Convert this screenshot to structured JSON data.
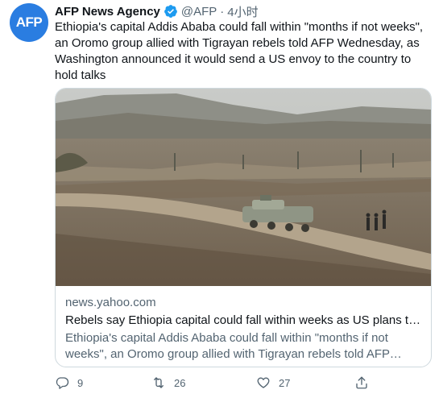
{
  "account": {
    "avatar_text": "AFP",
    "name": "AFP News Agency",
    "handle": "@AFP",
    "separator": "·",
    "time": "4小时"
  },
  "tweet": {
    "text": "Ethiopia's capital Addis Ababa could fall within \"months if not weeks\", an Oromo group allied with Tigrayan rebels told AFP Wednesday, as Washington announced it would send a US envoy to the country to hold talks"
  },
  "card": {
    "domain": "news.yahoo.com",
    "title": "Rebels say Ethiopia capital could fall within weeks as US plans to sen…",
    "description": "Ethiopia's capital Addis Ababa could fall within \"months if not weeks\", an Oromo group allied with Tigrayan rebels told AFP Wednesday, as …"
  },
  "actions": {
    "reply_count": "9",
    "retweet_count": "26",
    "like_count": "27"
  },
  "icons": {
    "verified": "verified-badge-icon",
    "reply": "reply-icon",
    "retweet": "retweet-icon",
    "like": "heart-icon",
    "share": "share-icon"
  },
  "colors": {
    "brand_blue": "#2a7de1",
    "verified_blue": "#1d9bf0",
    "text": "#0f1419",
    "secondary_text": "#536471",
    "border": "#cfd9de"
  }
}
